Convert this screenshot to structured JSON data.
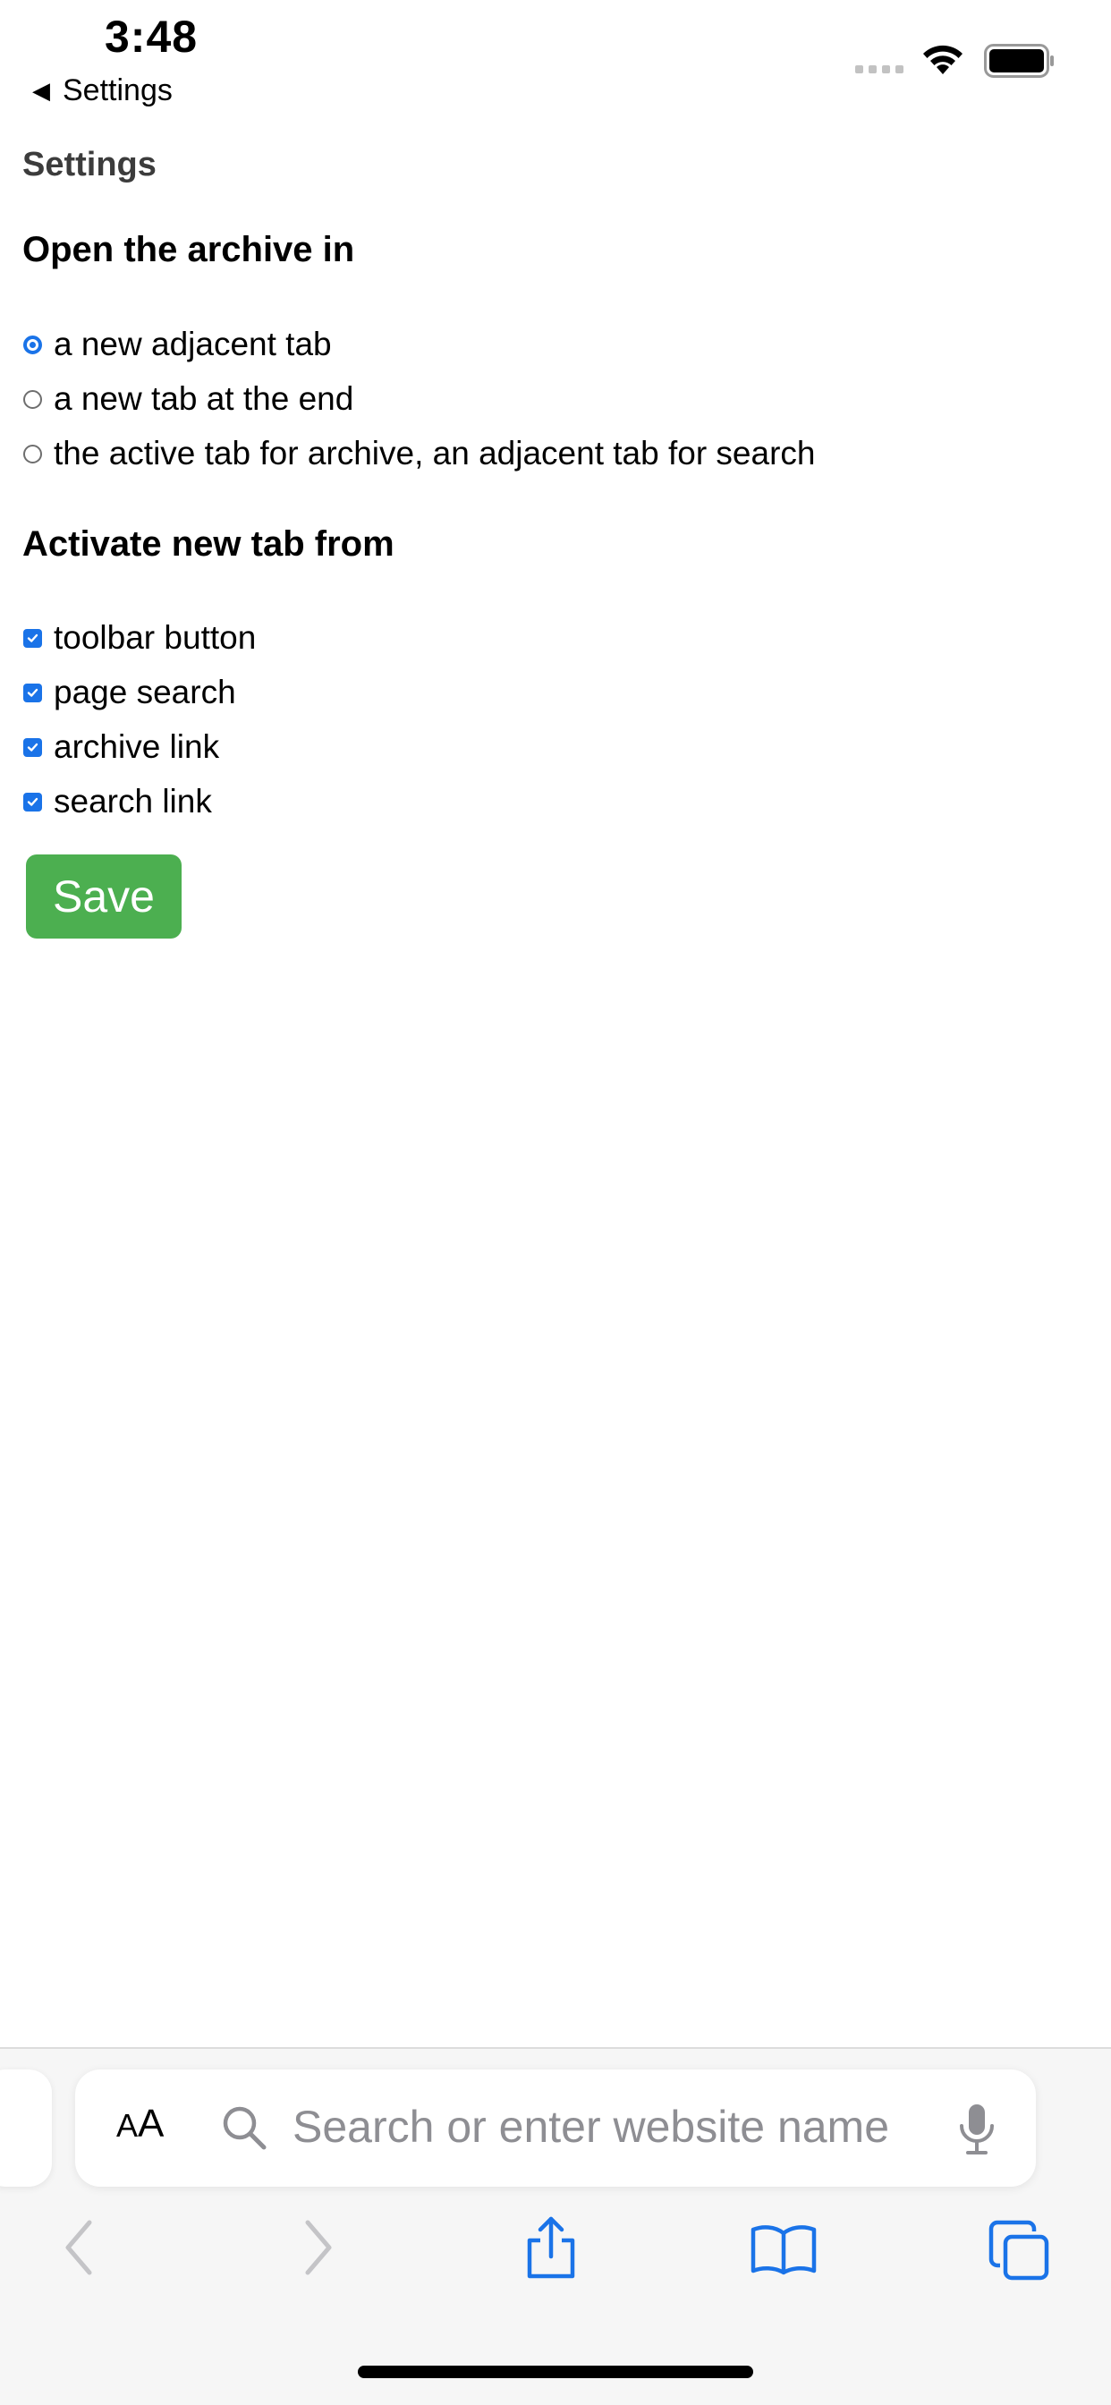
{
  "status_bar": {
    "time": "3:48",
    "back_label": "Settings"
  },
  "page": {
    "title": "Settings",
    "open_section": {
      "heading": "Open the archive in",
      "options": [
        {
          "label": "a new adjacent tab",
          "selected": true
        },
        {
          "label": "a new tab at the end",
          "selected": false
        },
        {
          "label": "the active tab for archive, an adjacent tab for search",
          "selected": false
        }
      ]
    },
    "activate_section": {
      "heading": "Activate new tab from",
      "options": [
        {
          "label": "toolbar button",
          "checked": true
        },
        {
          "label": "page search",
          "checked": true
        },
        {
          "label": "archive link",
          "checked": true
        },
        {
          "label": "search link",
          "checked": true
        }
      ]
    },
    "save_label": "Save"
  },
  "browser": {
    "text_size_label_small": "A",
    "text_size_label_large": "A",
    "address_placeholder": "Search or enter website name",
    "icons": [
      "back-icon",
      "forward-icon",
      "share-icon",
      "bookmarks-icon",
      "tabs-icon",
      "search-icon",
      "microphone-icon"
    ]
  },
  "colors": {
    "accent": "#1a73e8",
    "save_button": "#4caf50",
    "toolbar_icon": "#1a73e8",
    "disabled_icon": "#c4c4c7"
  }
}
